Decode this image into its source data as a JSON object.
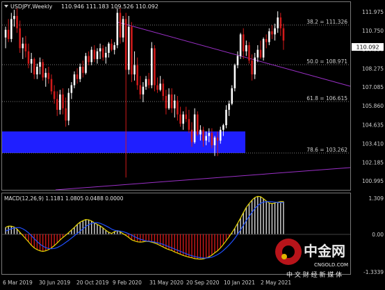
{
  "header": {
    "symbol": "USDJPY,Weekly",
    "ohlc": "110.946 111.183 109.526 110.092"
  },
  "price_axis": {
    "ticks": [
      "111.975",
      "110.750",
      "109.550",
      "108.275",
      "107.085",
      "105.860",
      "104.635",
      "103.410",
      "102.185",
      "100.995"
    ],
    "current_price": "110.092"
  },
  "fib_levels": [
    {
      "label": "38.2 = 111.326",
      "value": 111.326
    },
    {
      "label": "50.0 = 108.971",
      "value": 108.971
    },
    {
      "label": "61.8 = 106.615",
      "value": 106.615
    },
    {
      "label": "78.6 = 103.262",
      "value": 103.262
    }
  ],
  "macd": {
    "label": "MACD(12,26,9) 1.1181 1.0805 0.0488 0.0000",
    "ticks": [
      "1.309",
      "0.00",
      "-1.3339"
    ]
  },
  "time_axis": {
    "ticks": [
      "6 Mar 2019",
      "30 Jun 2019",
      "20 Oct 2019",
      "9 Feb 2020",
      "31 May 2020",
      "20 Sep 2020",
      "10 Jan 2021",
      "2 May 2021"
    ]
  },
  "watermark": {
    "brand": "中金网",
    "domain": "CNGOLD.COM",
    "slogan": "中 文 财 经 新 媒 体"
  },
  "colors": {
    "background": "#000000",
    "bull": "#ffffff",
    "bear": "#d11a1a",
    "trendline": "#9b30c8",
    "zone": "#1f1fff",
    "macd_line": "#e8d800",
    "signal_line": "#2050ff",
    "axis_text": "#cfcfcf"
  },
  "chart_data": [
    {
      "type": "candlestick",
      "title": "USDJPY,Weekly",
      "ylim": [
        100.4,
        112.6
      ],
      "x": [
        "6 Mar 2019",
        "30 Jun 2019",
        "20 Oct 2019",
        "9 Feb 2020",
        "31 May 2020",
        "20 Sep 2020",
        "10 Jan 2021",
        "2 May 2021"
      ],
      "candles": [
        [
          110.3,
          111.0,
          109.6,
          110.8
        ],
        [
          110.8,
          111.5,
          110.0,
          110.2
        ],
        [
          110.2,
          111.9,
          110.0,
          111.5
        ],
        [
          111.5,
          112.1,
          111.0,
          111.7
        ],
        [
          111.7,
          112.2,
          110.6,
          110.9
        ],
        [
          110.9,
          111.4,
          109.3,
          109.6
        ],
        [
          109.6,
          110.3,
          108.9,
          109.9
        ],
        [
          109.9,
          110.4,
          109.0,
          109.4
        ],
        [
          109.4,
          109.9,
          108.3,
          108.6
        ],
        [
          108.6,
          109.3,
          108.0,
          108.9
        ],
        [
          108.9,
          109.0,
          107.6,
          107.9
        ],
        [
          107.9,
          108.6,
          107.6,
          108.4
        ],
        [
          108.4,
          109.0,
          107.9,
          108.7
        ],
        [
          108.7,
          108.9,
          107.5,
          107.7
        ],
        [
          107.7,
          108.3,
          107.1,
          108.0
        ],
        [
          108.0,
          108.4,
          107.3,
          107.6
        ],
        [
          107.6,
          107.9,
          106.6,
          106.8
        ],
        [
          106.8,
          107.2,
          106.0,
          106.3
        ],
        [
          106.3,
          106.8,
          105.2,
          105.6
        ],
        [
          105.6,
          106.9,
          105.3,
          106.6
        ],
        [
          106.6,
          107.0,
          105.3,
          105.7
        ],
        [
          105.7,
          106.4,
          104.5,
          104.9
        ],
        [
          104.9,
          107.0,
          104.6,
          106.7
        ],
        [
          106.7,
          107.4,
          106.3,
          107.2
        ],
        [
          107.2,
          108.1,
          107.0,
          107.9
        ],
        [
          107.9,
          108.3,
          107.3,
          107.6
        ],
        [
          107.6,
          108.6,
          107.4,
          108.4
        ],
        [
          108.4,
          108.8,
          107.7,
          108.0
        ],
        [
          108.0,
          109.3,
          107.9,
          109.1
        ],
        [
          109.1,
          109.4,
          108.5,
          108.7
        ],
        [
          108.7,
          109.7,
          108.5,
          109.5
        ],
        [
          109.5,
          109.8,
          108.7,
          108.9
        ],
        [
          108.9,
          109.6,
          108.6,
          109.4
        ],
        [
          109.4,
          109.9,
          108.9,
          109.6
        ],
        [
          109.6,
          109.8,
          108.8,
          109.0
        ],
        [
          109.0,
          109.7,
          108.6,
          109.3
        ],
        [
          109.3,
          110.0,
          109.0,
          109.9
        ],
        [
          109.9,
          110.2,
          109.4,
          109.5
        ],
        [
          109.5,
          110.0,
          109.2,
          109.8
        ],
        [
          109.8,
          112.2,
          109.6,
          111.9
        ],
        [
          111.9,
          112.2,
          109.9,
          110.3
        ],
        [
          110.3,
          111.7,
          110.0,
          111.5
        ],
        [
          111.5,
          111.9,
          101.2,
          108.2
        ],
        [
          108.2,
          111.7,
          107.9,
          111.0
        ],
        [
          111.0,
          111.3,
          107.4,
          107.9
        ],
        [
          107.9,
          109.4,
          107.5,
          108.5
        ],
        [
          108.5,
          109.0,
          106.9,
          107.2
        ],
        [
          107.2,
          107.8,
          106.3,
          106.6
        ],
        [
          106.6,
          107.4,
          106.1,
          107.1
        ],
        [
          107.1,
          107.8,
          106.9,
          107.6
        ],
        [
          107.6,
          108.0,
          107.0,
          107.2
        ],
        [
          107.2,
          110.0,
          107.0,
          109.6
        ],
        [
          109.6,
          109.8,
          106.8,
          107.2
        ],
        [
          107.2,
          107.7,
          106.7,
          106.9
        ],
        [
          106.9,
          107.8,
          106.8,
          107.3
        ],
        [
          107.3,
          107.6,
          106.2,
          106.5
        ],
        [
          106.5,
          106.9,
          105.3,
          105.7
        ],
        [
          105.7,
          107.0,
          105.6,
          106.6
        ],
        [
          106.6,
          107.0,
          105.4,
          105.7
        ],
        [
          105.7,
          106.6,
          105.1,
          106.2
        ],
        [
          106.2,
          106.5,
          104.9,
          105.3
        ],
        [
          105.3,
          105.8,
          104.5,
          104.7
        ],
        [
          104.7,
          105.5,
          104.3,
          105.3
        ],
        [
          105.3,
          105.8,
          104.8,
          105.0
        ],
        [
          105.0,
          105.6,
          104.1,
          104.3
        ],
        [
          104.3,
          104.8,
          103.2,
          103.5
        ],
        [
          103.5,
          105.7,
          103.4,
          105.3
        ],
        [
          105.3,
          105.5,
          103.9,
          104.0
        ],
        [
          104.0,
          104.6,
          103.6,
          104.3
        ],
        [
          104.3,
          104.5,
          103.2,
          103.6
        ],
        [
          103.6,
          104.2,
          103.3,
          103.9
        ],
        [
          103.9,
          104.4,
          103.5,
          104.1
        ],
        [
          104.1,
          104.4,
          103.1,
          103.3
        ],
        [
          103.3,
          103.9,
          102.6,
          103.8
        ],
        [
          103.8,
          104.2,
          102.6,
          103.6
        ],
        [
          103.6,
          104.5,
          103.4,
          104.3
        ],
        [
          104.3,
          104.7,
          103.9,
          104.6
        ],
        [
          104.6,
          105.9,
          104.4,
          105.6
        ],
        [
          105.6,
          106.2,
          105.2,
          106.0
        ],
        [
          106.0,
          107.2,
          105.9,
          107.0
        ],
        [
          107.0,
          108.6,
          106.8,
          108.5
        ],
        [
          108.5,
          109.4,
          108.3,
          109.1
        ],
        [
          109.1,
          110.6,
          108.9,
          110.5
        ],
        [
          110.5,
          110.9,
          108.9,
          109.4
        ],
        [
          109.4,
          110.1,
          109.1,
          109.8
        ],
        [
          109.8,
          110.0,
          108.6,
          108.8
        ],
        [
          108.8,
          109.2,
          107.5,
          107.9
        ],
        [
          107.9,
          109.3,
          107.6,
          109.0
        ],
        [
          109.0,
          109.8,
          108.7,
          109.5
        ],
        [
          109.5,
          110.1,
          108.9,
          109.0
        ],
        [
          109.0,
          110.3,
          108.8,
          110.2
        ],
        [
          110.2,
          110.5,
          109.6,
          110.0
        ],
        [
          110.0,
          110.9,
          109.8,
          110.7
        ],
        [
          110.7,
          111.1,
          110.2,
          110.5
        ],
        [
          110.5,
          111.2,
          110.1,
          110.9
        ],
        [
          110.9,
          112.0,
          110.6,
          111.6
        ],
        [
          111.6,
          111.9,
          110.4,
          110.9
        ],
        [
          110.9,
          111.2,
          109.5,
          110.1
        ]
      ]
    },
    {
      "type": "bar",
      "title": "MACD(12,26,9)",
      "ylim": [
        -1.3339,
        1.309
      ],
      "series": [
        {
          "name": "MACD(12,26,9)",
          "values": [
            0.23,
            0.27,
            0.27,
            0.24,
            0.17,
            0.06,
            -0.05,
            -0.16,
            -0.27,
            -0.39,
            -0.48,
            -0.54,
            -0.58,
            -0.6,
            -0.58,
            -0.54,
            -0.48,
            -0.4,
            -0.31,
            -0.21,
            -0.12,
            -0.04,
            0.05,
            0.14,
            0.23,
            0.33,
            0.41,
            0.46,
            0.5,
            0.49,
            0.45,
            0.39,
            0.33,
            0.28,
            0.21,
            0.13,
            0.06,
            0.02,
            0.08,
            0.12,
            0.07,
            0.01,
            -0.05,
            -0.12,
            -0.2,
            -0.24,
            -0.27,
            -0.28,
            -0.27,
            -0.25,
            -0.26,
            -0.28,
            -0.31,
            -0.35,
            -0.4,
            -0.45,
            -0.5,
            -0.54,
            -0.57,
            -0.62,
            -0.66,
            -0.7,
            -0.74,
            -0.77,
            -0.8,
            -0.82,
            -0.85,
            -0.86,
            -0.87,
            -0.86,
            -0.83,
            -0.79,
            -0.73,
            -0.65,
            -0.58,
            -0.48,
            -0.36,
            -0.23,
            -0.1,
            0.05,
            0.2,
            0.37,
            0.55,
            0.74,
            0.92,
            1.05,
            1.17,
            1.26,
            1.3,
            1.29,
            1.22,
            1.14,
            1.07,
            1.05,
            1.07,
            1.1,
            1.12,
            1.12
          ]
        },
        {
          "name": "Signal",
          "values": [
            0.1,
            0.14,
            0.18,
            0.21,
            0.22,
            0.22,
            0.18,
            0.12,
            0.04,
            -0.06,
            -0.16,
            -0.26,
            -0.35,
            -0.42,
            -0.47,
            -0.5,
            -0.51,
            -0.5,
            -0.47,
            -0.42,
            -0.36,
            -0.29,
            -0.22,
            -0.14,
            -0.06,
            0.02,
            0.1,
            0.18,
            0.26,
            0.32,
            0.37,
            0.39,
            0.39,
            0.37,
            0.33,
            0.28,
            0.23,
            0.17,
            0.13,
            0.11,
            0.1,
            0.08,
            0.05,
            0.01,
            -0.04,
            -0.09,
            -0.14,
            -0.18,
            -0.21,
            -0.24,
            -0.25,
            -0.26,
            -0.28,
            -0.3,
            -0.33,
            -0.36,
            -0.4,
            -0.44,
            -0.48,
            -0.52,
            -0.56,
            -0.6,
            -0.64,
            -0.68,
            -0.72,
            -0.75,
            -0.78,
            -0.8,
            -0.82,
            -0.83,
            -0.83,
            -0.82,
            -0.8,
            -0.76,
            -0.71,
            -0.65,
            -0.57,
            -0.48,
            -0.38,
            -0.27,
            -0.15,
            -0.01,
            0.14,
            0.3,
            0.46,
            0.61,
            0.75,
            0.88,
            0.98,
            1.06,
            1.1,
            1.12,
            1.12,
            1.11,
            1.1,
            1.09,
            1.09,
            1.08
          ]
        }
      ]
    }
  ]
}
